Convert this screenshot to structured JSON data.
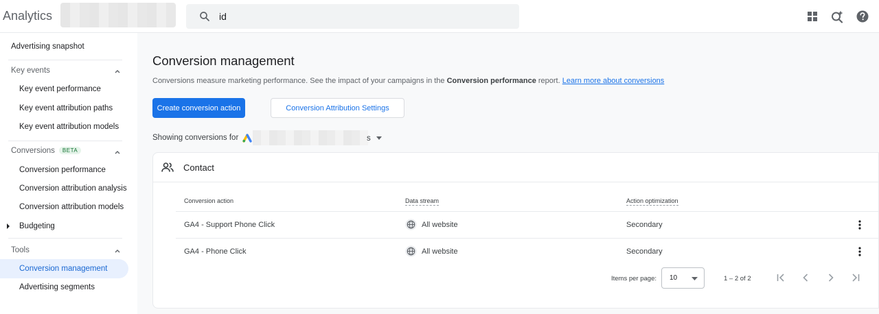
{
  "header": {
    "app_title": "Analytics",
    "search_value": "id",
    "icons": [
      "apps-icon",
      "search-insights-icon",
      "help-icon"
    ]
  },
  "sidebar": {
    "advertising_snapshot": "Advertising snapshot",
    "key_events": {
      "label": "Key events",
      "items": [
        "Key event performance",
        "Key event attribution paths",
        "Key event attribution models"
      ]
    },
    "conversions": {
      "label": "Conversions",
      "badge": "BETA",
      "items": [
        "Conversion performance",
        "Conversion attribution analysis",
        "Conversion attribution models"
      ]
    },
    "budgeting": "Budgeting",
    "tools": {
      "label": "Tools",
      "items": [
        "Conversion management",
        "Advertising segments"
      ],
      "active": "Conversion management"
    }
  },
  "main": {
    "title": "Conversion management",
    "description_prefix": "Conversions measure marketing performance. See the impact of your campaigns in the ",
    "description_bold": "Conversion performance",
    "description_suffix": " report. ",
    "learn_more": "Learn more about conversions",
    "create_button": "Create conversion action",
    "settings_button": "Conversion Attribution Settings",
    "showing_label": "Showing conversions for",
    "account_suffix": "s"
  },
  "card": {
    "title": "Contact",
    "columns": [
      "Conversion action",
      "Data stream",
      "Action optimization"
    ],
    "rows": [
      {
        "action": "GA4 - Support Phone Click",
        "stream": "All website",
        "optimization": "Secondary"
      },
      {
        "action": "GA4 - Phone Click",
        "stream": "All website",
        "optimization": "Secondary"
      }
    ],
    "pagination": {
      "items_per_page_label": "Items per page:",
      "items_per_page": "10",
      "range": "1 – 2 of 2"
    }
  },
  "colors": {
    "accent": "#1a73e8",
    "active_nav_bg": "#e8f0fe",
    "page_bg": "#f8f9fa"
  }
}
